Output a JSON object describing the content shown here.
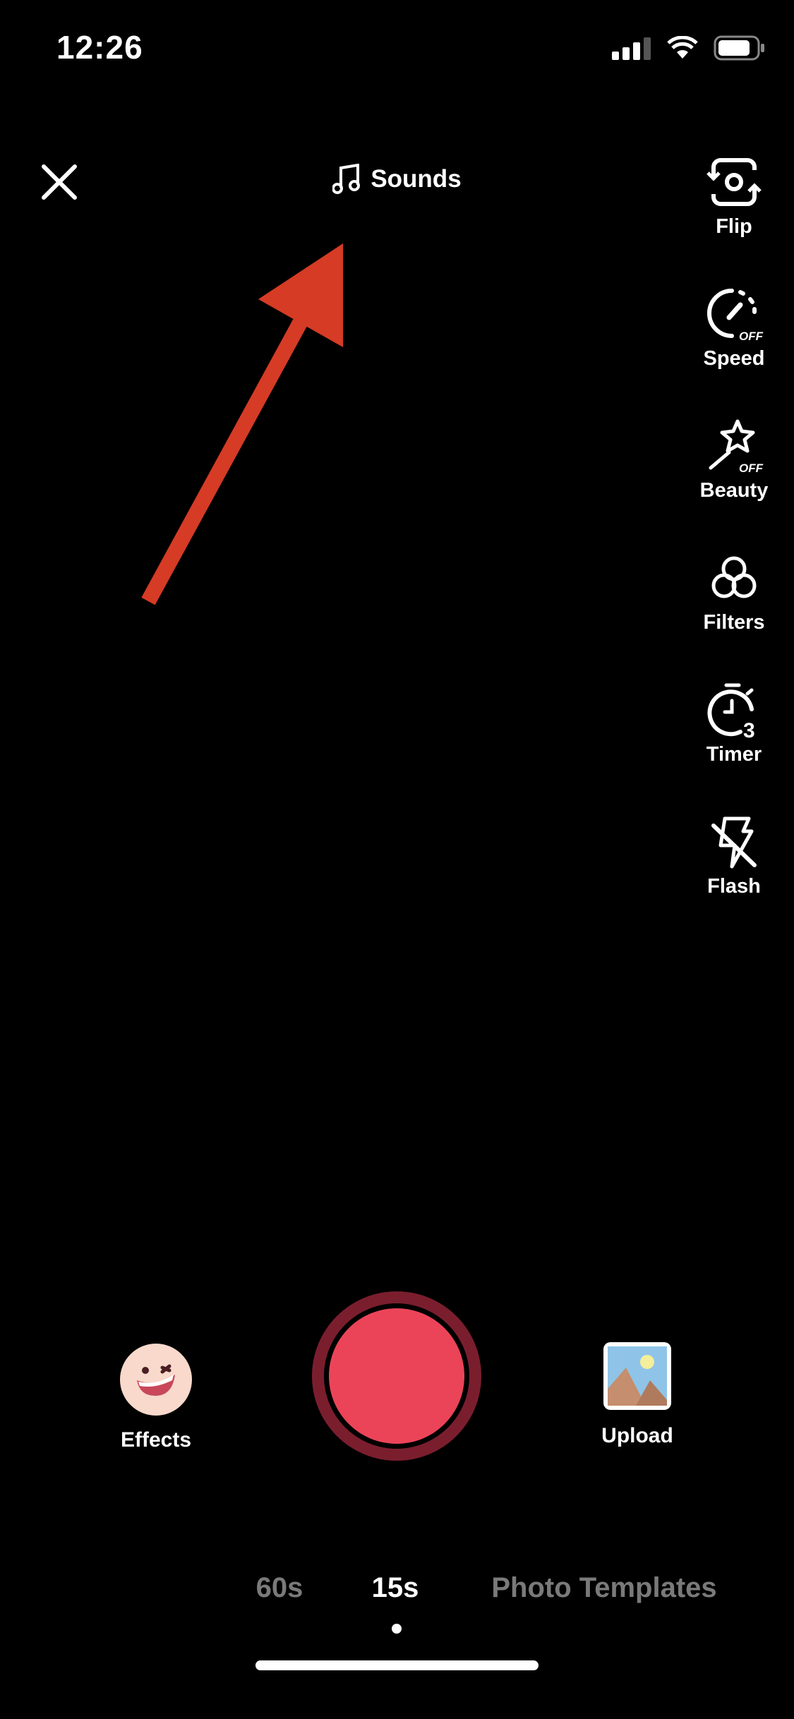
{
  "status_bar": {
    "time": "12:26",
    "signal_icon": "cellular-signal-icon",
    "wifi_icon": "wifi-icon",
    "battery_icon": "battery-icon"
  },
  "top": {
    "close_icon": "close-icon",
    "sounds_label": "Sounds",
    "sounds_icon": "music-note-icon"
  },
  "side_tools": [
    {
      "label": "Flip",
      "icon": "flip-camera-icon"
    },
    {
      "label": "Speed",
      "icon": "speed-icon",
      "badge": "OFF"
    },
    {
      "label": "Beauty",
      "icon": "beauty-wand-icon",
      "badge": "OFF"
    },
    {
      "label": "Filters",
      "icon": "filters-icon"
    },
    {
      "label": "Timer",
      "icon": "timer-icon",
      "badge": "3"
    },
    {
      "label": "Flash",
      "icon": "flash-off-icon"
    }
  ],
  "bottom": {
    "effects_label": "Effects",
    "upload_label": "Upload",
    "record_color": "#EB4459",
    "record_ring_color": "#7A1E2E"
  },
  "modes": [
    {
      "label": "60s",
      "active": false
    },
    {
      "label": "15s",
      "active": true
    },
    {
      "label": "Photo Templates",
      "active": false
    }
  ],
  "annotation": {
    "arrow_color": "#D63B25"
  }
}
